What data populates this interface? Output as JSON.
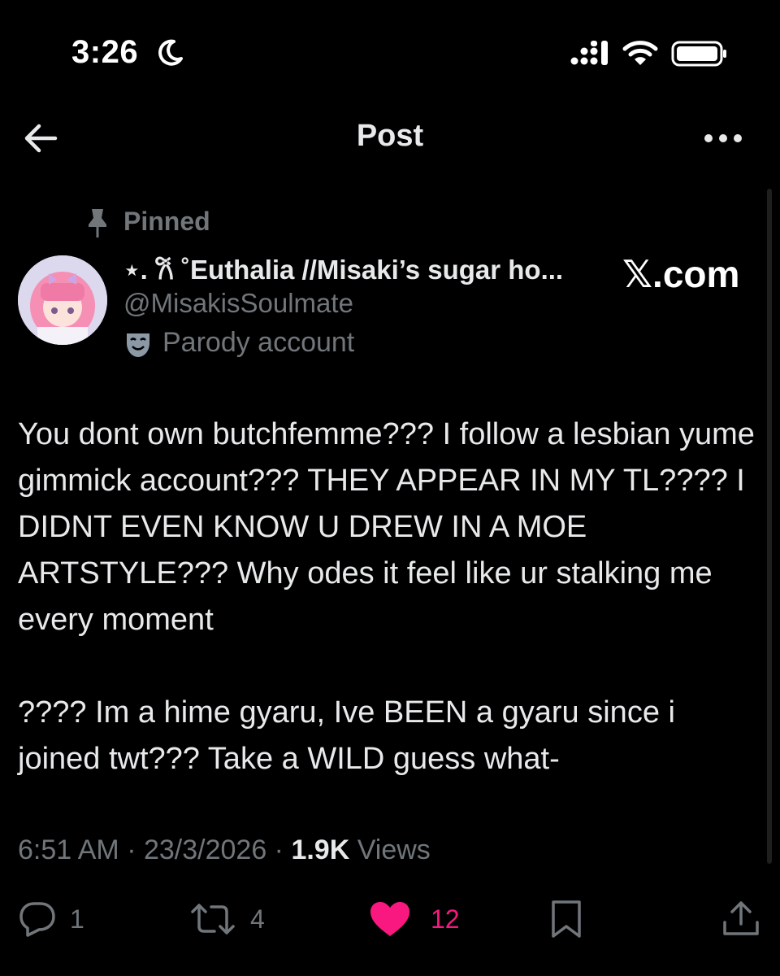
{
  "status_bar": {
    "time": "3:26",
    "icons": [
      "moon-icon",
      "cellular-signal-icon",
      "wifi-icon",
      "battery-icon"
    ]
  },
  "header": {
    "title": "Post",
    "icons": [
      "back-arrow-icon",
      "more-options-icon"
    ]
  },
  "post": {
    "pinned_label": "Pinned",
    "author": {
      "display_name": "⋆. 𐙚 ˚Euthalia //Misaki’s sugar ho...",
      "handle": "@MisakisSoulmate",
      "account_label": "Parody account"
    },
    "watermark": "𝕏.com",
    "paragraphs": [
      "You dont own butchfemme??? I follow a lesbian yume gimmick account??? THEY APPEAR IN MY TL???? I DIDNT EVEN KNOW U DREW IN A MOE ARTSTYLE??? Why odes it feel like ur stalking me every moment",
      "???? Im a hime gyaru, Ive BEEN a gyaru since i joined twt??? Take a WILD guess what-"
    ],
    "meta": {
      "time": "6:51 AM",
      "sep1": " · ",
      "date": "23/3/2026",
      "sep2": " · ",
      "views_count": "1.9K",
      "views_label": " Views"
    },
    "actions": {
      "replies": "1",
      "reposts": "4",
      "likes": "12",
      "liked": true
    }
  },
  "colors": {
    "background": "#000000",
    "text": "#e7e9ea",
    "secondary": "#71767b",
    "like": "#f91880"
  }
}
